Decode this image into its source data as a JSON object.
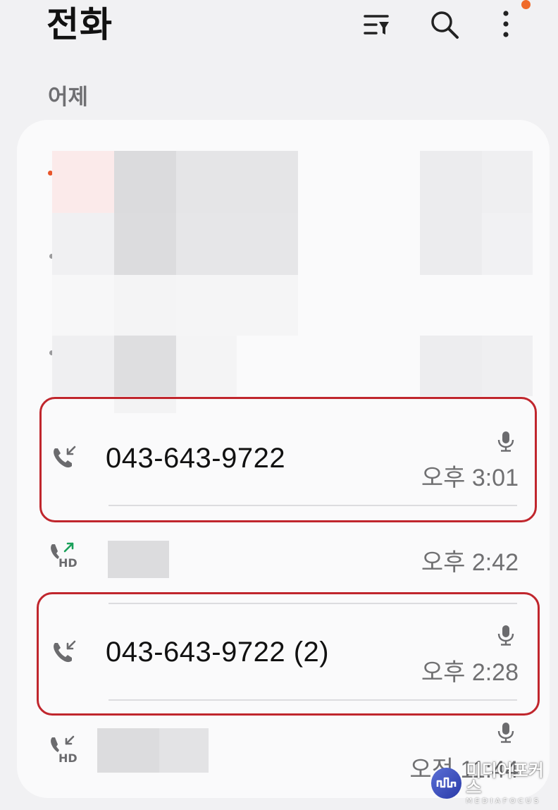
{
  "header": {
    "title": "전화",
    "icons": [
      "filter-icon",
      "search-icon",
      "more-options-icon"
    ]
  },
  "section": {
    "label": "어제"
  },
  "calls": [
    {
      "number": "043-643-9722",
      "time": "오후 3:01",
      "type": "incoming",
      "hd": false,
      "recorded": true,
      "highlighted": true
    },
    {
      "number": "",
      "time": "오후 2:42",
      "type": "outgoing",
      "hd": true,
      "recorded": false,
      "highlighted": false
    },
    {
      "number": "043-643-9722 (2)",
      "time": "오후 2:28",
      "type": "incoming",
      "hd": false,
      "recorded": true,
      "highlighted": true
    },
    {
      "number": "",
      "time": "오전 11:44",
      "type": "incoming",
      "hd": true,
      "recorded": true,
      "highlighted": false
    }
  ],
  "badges": {
    "hd": "HD"
  },
  "watermark": {
    "main": "미디어포커스",
    "sub": "MEDIAFOCUS"
  },
  "colors": {
    "highlight": "#c0262d",
    "missed_dot": "#e8552a",
    "outgoing_arrow": "#1aa05a",
    "notification_dot": "#ef6a2a"
  }
}
